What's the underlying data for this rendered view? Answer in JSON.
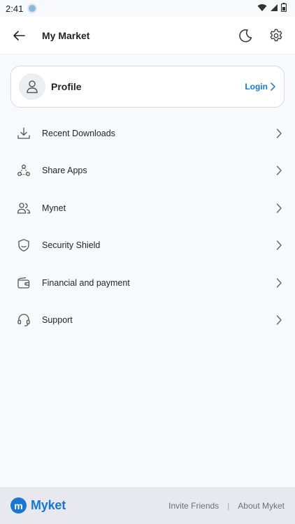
{
  "status_bar": {
    "time": "2:41",
    "icons": [
      "app-notification-icon",
      "wifi-icon",
      "signal-icon",
      "battery-icon"
    ]
  },
  "app_bar": {
    "title": "My Market",
    "back_icon": "arrow-left-icon",
    "actions": [
      "moon-icon",
      "gear-icon"
    ]
  },
  "profile": {
    "label": "Profile",
    "login_label": "Login"
  },
  "menu": {
    "items": [
      {
        "label": "Recent Downloads",
        "icon": "download-icon"
      },
      {
        "label": "Share Apps",
        "icon": "share-icon"
      },
      {
        "label": "Mynet",
        "icon": "people-icon"
      },
      {
        "label": "Security Shield",
        "icon": "shield-icon"
      },
      {
        "label": "Financial and payment",
        "icon": "wallet-icon"
      },
      {
        "label": "Support",
        "icon": "headset-icon"
      }
    ]
  },
  "footer": {
    "brand_name": "Myket",
    "brand_logo_letter": "m",
    "links": {
      "invite": "Invite Friends",
      "separator": "|",
      "about": "About Myket"
    }
  },
  "colors": {
    "accent": "#1976d2",
    "background": "#f8f9fc",
    "footer_bg": "#e7e9ee"
  }
}
